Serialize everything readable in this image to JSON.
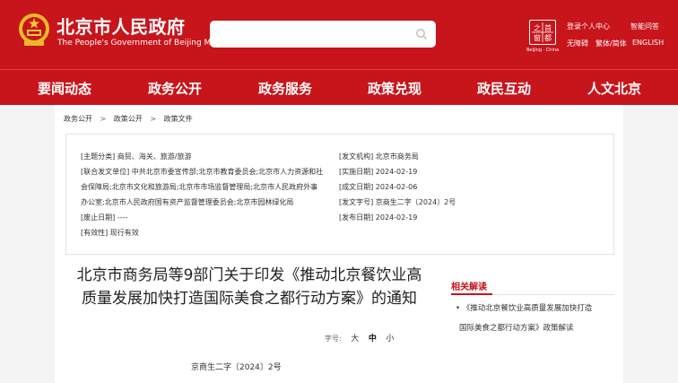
{
  "header": {
    "site_title_cn": "北京市人民政府",
    "site_title_en": "The People's Government of Beijing Municipality",
    "search_placeholder": "",
    "capital_logo_text": "Beijing · China",
    "links": {
      "login": "登录个人中心",
      "smart_qa": "智能问答",
      "accessibility": "无障碍",
      "traditional": "繁体/简体",
      "english": "ENGLISH"
    }
  },
  "nav": {
    "items": [
      "要闻动态",
      "政务公开",
      "政务服务",
      "政策兑现",
      "政民互动",
      "人文北京"
    ]
  },
  "breadcrumb": [
    "政务公开",
    ">",
    "政策公开",
    ">",
    "政策文件"
  ],
  "meta": {
    "subject_label": "[主题分类]",
    "subject_value": "商贸、海关、旅游/旅游",
    "issuer_label": "[发文机构]",
    "issuer_value": "北京市商务局",
    "joint_label": "[联合发文单位]",
    "joint_value_1": "中共北京市委宣传部;北京市教育委员会;北京市人力资源和社",
    "joint_value_2": "会保障局;北京市文化和旅游局;北京市市场监督管理局;北京市人民政府外事",
    "joint_value_3": "办公室;北京市人民政府国有资产监督管理委员会;北京市园林绿化局",
    "impl_label": "[实施日期]",
    "impl_value": "2024-02-19",
    "written_label": "[成文日期]",
    "written_value": "2024-02-06",
    "docno_label": "[发文字号]",
    "docno_value": "京商生二字〔2024〕2号",
    "expire_label": "[废止日期]",
    "expire_value": "----",
    "publish_label": "[发布日期]",
    "publish_value": "2024-02-19",
    "valid_label": "[有效性]",
    "valid_value": "现行有效"
  },
  "document": {
    "title": "北京市商务局等9部门关于印发《推动北京餐饮业高质量发展加快打造国际美食之都行动方案》的通知",
    "font_size_label": "字号:",
    "font_sizes": [
      "大",
      "中",
      "小"
    ],
    "doc_number": "京商生二字〔2024〕2号"
  },
  "related": {
    "title": "相关解读",
    "item_line1": "• 《推动北京餐饮业高质量发展加快打造",
    "item_line2": "国际美食之都行动方案》政策解读"
  },
  "colors": {
    "brand_red": "#c8141b",
    "page_bg": "#f3f3f3"
  }
}
